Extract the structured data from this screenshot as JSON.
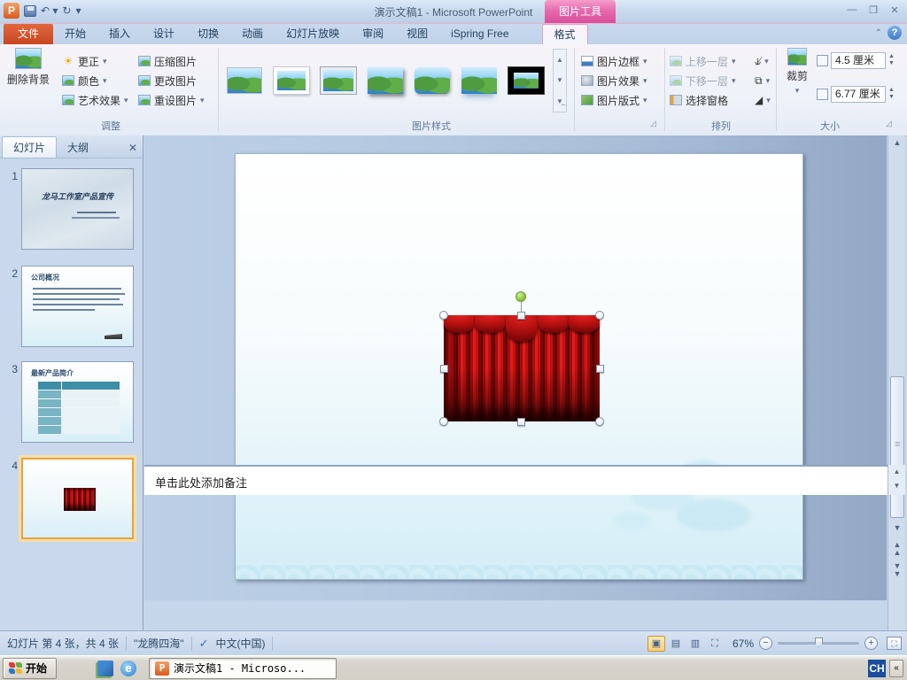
{
  "titlebar": {
    "title": "演示文稿1 - Microsoft PowerPoint",
    "contextual_tool": "图片工具"
  },
  "ribbon_tabs": [
    "文件",
    "开始",
    "插入",
    "设计",
    "切换",
    "动画",
    "幻灯片放映",
    "审阅",
    "视图",
    "iSpring Free",
    "格式"
  ],
  "ribbon": {
    "adjust": {
      "label": "调整",
      "remove_background": "删除背景",
      "corrections": "更正",
      "color": "颜色",
      "artistic_effects": "艺术效果",
      "compress_picture": "压缩图片",
      "change_picture": "更改图片",
      "reset_picture": "重设图片"
    },
    "styles": {
      "label": "图片样式"
    },
    "picture_border": "图片边框",
    "picture_effects": "图片效果",
    "picture_layout": "图片版式",
    "arrange": {
      "label": "排列",
      "bring_forward": "上移一层",
      "send_backward": "下移一层",
      "selection_pane": "选择窗格"
    },
    "size": {
      "label": "大小",
      "crop": "裁剪",
      "height_value": "4.5 厘米",
      "width_value": "6.77 厘米"
    }
  },
  "slides_panel": {
    "tab_slides": "幻灯片",
    "tab_outline": "大纲",
    "slide1_num": "1",
    "slide1_title": "龙马工作室产品宣传",
    "slide2_num": "2",
    "slide2_title": "公司概况",
    "slide3_num": "3",
    "slide3_title": "最新产品简介",
    "slide4_num": "4"
  },
  "notes": {
    "placeholder": "单击此处添加备注"
  },
  "status_bar": {
    "slide_info": "幻灯片 第 4 张，共 4 张",
    "theme": "\"龙腾四海\"",
    "language": "中文(中国)",
    "zoom_level": "67%",
    "zoom_out": "−",
    "zoom_in": "+"
  },
  "taskbar": {
    "start": "开始",
    "task": "演示文稿1 - Microso...",
    "lang_indicator": "CH"
  }
}
